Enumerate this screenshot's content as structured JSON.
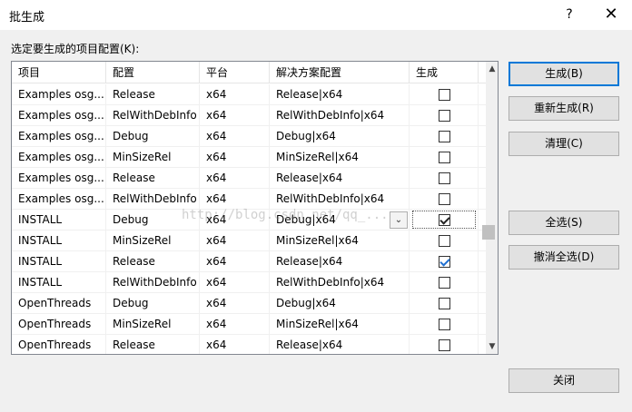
{
  "window": {
    "title": "批生成",
    "help_label": "?",
    "close_label": "✕"
  },
  "prompt": "选定要生成的项目配置(K):",
  "columns": [
    "项目",
    "配置",
    "平台",
    "解决方案配置",
    "生成"
  ],
  "rows": [
    {
      "project": "Examples osg...",
      "config": "Release",
      "platform": "x64",
      "solution": "Release|x64",
      "build": false
    },
    {
      "project": "Examples osg...",
      "config": "RelWithDebInfo",
      "platform": "x64",
      "solution": "RelWithDebInfo|x64",
      "build": false
    },
    {
      "project": "Examples osg...",
      "config": "Debug",
      "platform": "x64",
      "solution": "Debug|x64",
      "build": false
    },
    {
      "project": "Examples osg...",
      "config": "MinSizeRel",
      "platform": "x64",
      "solution": "MinSizeRel|x64",
      "build": false
    },
    {
      "project": "Examples osg...",
      "config": "Release",
      "platform": "x64",
      "solution": "Release|x64",
      "build": false
    },
    {
      "project": "Examples osg...",
      "config": "RelWithDebInfo",
      "platform": "x64",
      "solution": "RelWithDebInfo|x64",
      "build": false
    },
    {
      "project": "INSTALL",
      "config": "Debug",
      "platform": "x64",
      "solution": "Debug|x64",
      "build": true
    },
    {
      "project": "INSTALL",
      "config": "MinSizeRel",
      "platform": "x64",
      "solution": "MinSizeRel|x64",
      "build": false
    },
    {
      "project": "INSTALL",
      "config": "Release",
      "platform": "x64",
      "solution": "Release|x64",
      "build": true
    },
    {
      "project": "INSTALL",
      "config": "RelWithDebInfo",
      "platform": "x64",
      "solution": "RelWithDebInfo|x64",
      "build": false
    },
    {
      "project": "OpenThreads",
      "config": "Debug",
      "platform": "x64",
      "solution": "Debug|x64",
      "build": false
    },
    {
      "project": "OpenThreads",
      "config": "MinSizeRel",
      "platform": "x64",
      "solution": "MinSizeRel|x64",
      "build": false
    },
    {
      "project": "OpenThreads",
      "config": "Release",
      "platform": "x64",
      "solution": "Release|x64",
      "build": false
    }
  ],
  "buttons": {
    "build": "生成(B)",
    "rebuild": "重新生成(R)",
    "clean": "清理(C)",
    "select_all": "全选(S)",
    "deselect_all": "撤消全选(D)",
    "close": "关闭"
  },
  "watermark": "http://blog.csdn.net/qq_..."
}
